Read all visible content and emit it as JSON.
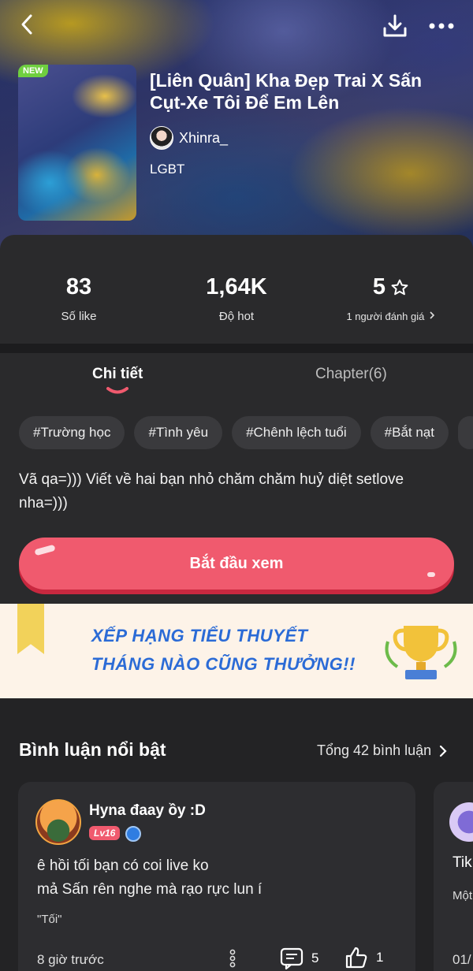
{
  "header": {
    "back_icon": "chevron-left-icon",
    "download_icon": "download-icon",
    "more_icon": "more-horizontal-icon"
  },
  "story": {
    "badge": "NEW",
    "title": "[Liên Quân] Kha Đẹp Trai X Sấn Cụt-Xe Tôi Để Em Lên",
    "author": "Xhinra_",
    "genre": "LGBT"
  },
  "stats": {
    "likes_value": "83",
    "likes_label": "Số like",
    "hot_value": "1,64K",
    "hot_label": "Độ hot",
    "rating_value": "5",
    "rating_label": "1 người đánh giá"
  },
  "tabs": {
    "detail": "Chi tiết",
    "chapter": "Chapter(6)"
  },
  "tags": [
    "#Trường học",
    "#Tình yêu",
    "#Chênh lệch tuổi",
    "#Bắt nạt"
  ],
  "description": "Vã qa=))) Viết về hai bạn nhỏ chăm chăm huỷ diệt setlove nha=)))",
  "start_button": "Bắt đầu xem",
  "banner": {
    "line1": "XẾP HẠNG TIỂU THUYẾT",
    "line2": "THÁNG NÀO CŨNG THƯỞNG!!"
  },
  "comments": {
    "title": "Bình luận nổi bật",
    "total": "Tổng 42 bình luận",
    "items": [
      {
        "user": "Hyna đaay ồy :D",
        "level": "Lv16",
        "line1": "ê hồi tối bạn có coi live ko",
        "line2": "mả Sấn rên nghe mà rạo rực lun í",
        "quote": "\"Tối\"",
        "time": "8 giờ trước",
        "replies": "5",
        "likes": "1"
      }
    ],
    "peek": {
      "line1": "Tik",
      "line2": "Một",
      "time": "01/"
    }
  },
  "colors": {
    "accent": "#f05a6e",
    "background": "#232325",
    "card": "#2a2a2c",
    "banner_text": "#2b6bd6"
  }
}
